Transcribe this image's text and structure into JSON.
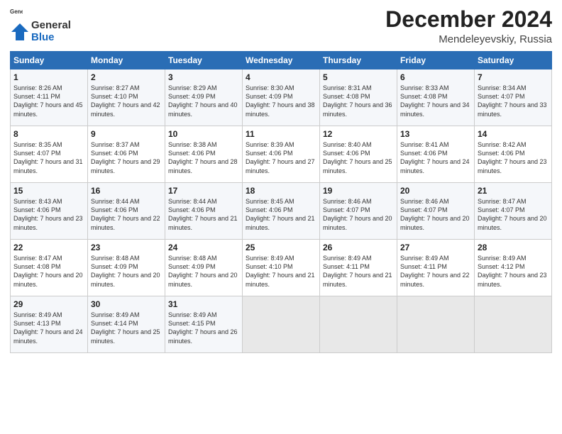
{
  "logo": {
    "line1": "General",
    "line2": "Blue"
  },
  "title": "December 2024",
  "location": "Mendeleyevskiy, Russia",
  "days_of_week": [
    "Sunday",
    "Monday",
    "Tuesday",
    "Wednesday",
    "Thursday",
    "Friday",
    "Saturday"
  ],
  "weeks": [
    [
      {
        "day": "1",
        "sunrise": "Sunrise: 8:26 AM",
        "sunset": "Sunset: 4:11 PM",
        "daylight": "Daylight: 7 hours and 45 minutes."
      },
      {
        "day": "2",
        "sunrise": "Sunrise: 8:27 AM",
        "sunset": "Sunset: 4:10 PM",
        "daylight": "Daylight: 7 hours and 42 minutes."
      },
      {
        "day": "3",
        "sunrise": "Sunrise: 8:29 AM",
        "sunset": "Sunset: 4:09 PM",
        "daylight": "Daylight: 7 hours and 40 minutes."
      },
      {
        "day": "4",
        "sunrise": "Sunrise: 8:30 AM",
        "sunset": "Sunset: 4:09 PM",
        "daylight": "Daylight: 7 hours and 38 minutes."
      },
      {
        "day": "5",
        "sunrise": "Sunrise: 8:31 AM",
        "sunset": "Sunset: 4:08 PM",
        "daylight": "Daylight: 7 hours and 36 minutes."
      },
      {
        "day": "6",
        "sunrise": "Sunrise: 8:33 AM",
        "sunset": "Sunset: 4:08 PM",
        "daylight": "Daylight: 7 hours and 34 minutes."
      },
      {
        "day": "7",
        "sunrise": "Sunrise: 8:34 AM",
        "sunset": "Sunset: 4:07 PM",
        "daylight": "Daylight: 7 hours and 33 minutes."
      }
    ],
    [
      {
        "day": "8",
        "sunrise": "Sunrise: 8:35 AM",
        "sunset": "Sunset: 4:07 PM",
        "daylight": "Daylight: 7 hours and 31 minutes."
      },
      {
        "day": "9",
        "sunrise": "Sunrise: 8:37 AM",
        "sunset": "Sunset: 4:06 PM",
        "daylight": "Daylight: 7 hours and 29 minutes."
      },
      {
        "day": "10",
        "sunrise": "Sunrise: 8:38 AM",
        "sunset": "Sunset: 4:06 PM",
        "daylight": "Daylight: 7 hours and 28 minutes."
      },
      {
        "day": "11",
        "sunrise": "Sunrise: 8:39 AM",
        "sunset": "Sunset: 4:06 PM",
        "daylight": "Daylight: 7 hours and 27 minutes."
      },
      {
        "day": "12",
        "sunrise": "Sunrise: 8:40 AM",
        "sunset": "Sunset: 4:06 PM",
        "daylight": "Daylight: 7 hours and 25 minutes."
      },
      {
        "day": "13",
        "sunrise": "Sunrise: 8:41 AM",
        "sunset": "Sunset: 4:06 PM",
        "daylight": "Daylight: 7 hours and 24 minutes."
      },
      {
        "day": "14",
        "sunrise": "Sunrise: 8:42 AM",
        "sunset": "Sunset: 4:06 PM",
        "daylight": "Daylight: 7 hours and 23 minutes."
      }
    ],
    [
      {
        "day": "15",
        "sunrise": "Sunrise: 8:43 AM",
        "sunset": "Sunset: 4:06 PM",
        "daylight": "Daylight: 7 hours and 23 minutes."
      },
      {
        "day": "16",
        "sunrise": "Sunrise: 8:44 AM",
        "sunset": "Sunset: 4:06 PM",
        "daylight": "Daylight: 7 hours and 22 minutes."
      },
      {
        "day": "17",
        "sunrise": "Sunrise: 8:44 AM",
        "sunset": "Sunset: 4:06 PM",
        "daylight": "Daylight: 7 hours and 21 minutes."
      },
      {
        "day": "18",
        "sunrise": "Sunrise: 8:45 AM",
        "sunset": "Sunset: 4:06 PM",
        "daylight": "Daylight: 7 hours and 21 minutes."
      },
      {
        "day": "19",
        "sunrise": "Sunrise: 8:46 AM",
        "sunset": "Sunset: 4:07 PM",
        "daylight": "Daylight: 7 hours and 20 minutes."
      },
      {
        "day": "20",
        "sunrise": "Sunrise: 8:46 AM",
        "sunset": "Sunset: 4:07 PM",
        "daylight": "Daylight: 7 hours and 20 minutes."
      },
      {
        "day": "21",
        "sunrise": "Sunrise: 8:47 AM",
        "sunset": "Sunset: 4:07 PM",
        "daylight": "Daylight: 7 hours and 20 minutes."
      }
    ],
    [
      {
        "day": "22",
        "sunrise": "Sunrise: 8:47 AM",
        "sunset": "Sunset: 4:08 PM",
        "daylight": "Daylight: 7 hours and 20 minutes."
      },
      {
        "day": "23",
        "sunrise": "Sunrise: 8:48 AM",
        "sunset": "Sunset: 4:09 PM",
        "daylight": "Daylight: 7 hours and 20 minutes."
      },
      {
        "day": "24",
        "sunrise": "Sunrise: 8:48 AM",
        "sunset": "Sunset: 4:09 PM",
        "daylight": "Daylight: 7 hours and 20 minutes."
      },
      {
        "day": "25",
        "sunrise": "Sunrise: 8:49 AM",
        "sunset": "Sunset: 4:10 PM",
        "daylight": "Daylight: 7 hours and 21 minutes."
      },
      {
        "day": "26",
        "sunrise": "Sunrise: 8:49 AM",
        "sunset": "Sunset: 4:11 PM",
        "daylight": "Daylight: 7 hours and 21 minutes."
      },
      {
        "day": "27",
        "sunrise": "Sunrise: 8:49 AM",
        "sunset": "Sunset: 4:11 PM",
        "daylight": "Daylight: 7 hours and 22 minutes."
      },
      {
        "day": "28",
        "sunrise": "Sunrise: 8:49 AM",
        "sunset": "Sunset: 4:12 PM",
        "daylight": "Daylight: 7 hours and 23 minutes."
      }
    ],
    [
      {
        "day": "29",
        "sunrise": "Sunrise: 8:49 AM",
        "sunset": "Sunset: 4:13 PM",
        "daylight": "Daylight: 7 hours and 24 minutes."
      },
      {
        "day": "30",
        "sunrise": "Sunrise: 8:49 AM",
        "sunset": "Sunset: 4:14 PM",
        "daylight": "Daylight: 7 hours and 25 minutes."
      },
      {
        "day": "31",
        "sunrise": "Sunrise: 8:49 AM",
        "sunset": "Sunset: 4:15 PM",
        "daylight": "Daylight: 7 hours and 26 minutes."
      },
      null,
      null,
      null,
      null
    ]
  ]
}
